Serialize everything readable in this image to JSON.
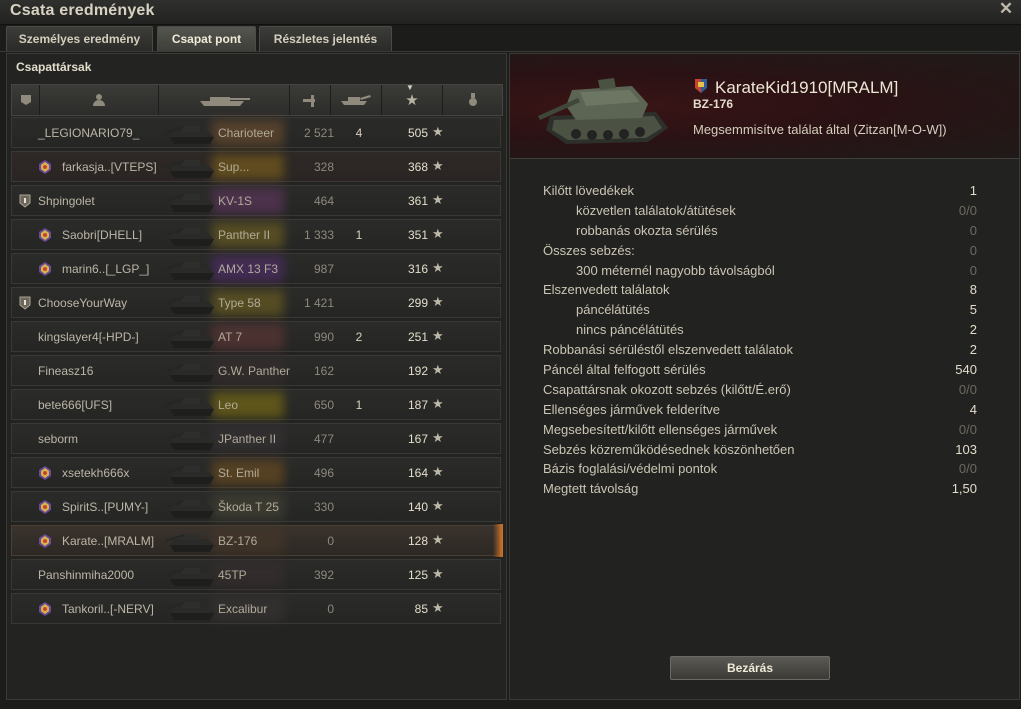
{
  "window": {
    "title": "Csata eredmények"
  },
  "tabs": [
    {
      "label": "Személyes eredmény",
      "active": false
    },
    {
      "label": "Csapat pont",
      "active": true
    },
    {
      "label": "Részletes jelentés",
      "active": false
    }
  ],
  "team": {
    "section_title": "Csapattársak",
    "columns": [
      "squad-icon",
      "player-icon",
      "tank-icon",
      "damage-icon",
      "kills-icon",
      "points-icon",
      "medal-icon"
    ],
    "rows": [
      {
        "name": "_LEGIONARIO79_",
        "badge": "none",
        "vehicle": "Charioteer",
        "damage": "2 521",
        "kills": "4",
        "points": "505",
        "dead": false,
        "color": "#7a5530"
      },
      {
        "name": "farkasja..[VTEPS]",
        "badge": "clan-emblem",
        "vehicle": "Sup...",
        "damage": "328",
        "kills": "",
        "points": "368",
        "dead": true,
        "color": "#8a6a1a"
      },
      {
        "name": "Shpingolet",
        "badge": "platoon",
        "vehicle": "KV-1S",
        "damage": "464",
        "kills": "",
        "points": "361",
        "dead": false,
        "color": "#6a3a6a"
      },
      {
        "name": "Saobri[DHELL]",
        "badge": "clan-emblem",
        "vehicle": "Panther II",
        "damage": "1 333",
        "kills": "1",
        "points": "351",
        "dead": false,
        "color": "#7a6a20"
      },
      {
        "name": "marin6..[_LGP_]",
        "badge": "clan-emblem",
        "vehicle": "AMX 13 F3",
        "damage": "987",
        "kills": "",
        "points": "316",
        "dead": false,
        "color": "#5a2f7a"
      },
      {
        "name": "ChooseYourWay",
        "badge": "platoon",
        "vehicle": "Type 58",
        "damage": "1 421",
        "kills": "",
        "points": "299",
        "dead": false,
        "color": "#7a6a20"
      },
      {
        "name": "kingslayer4[-HPD-]",
        "badge": "none",
        "vehicle": "AT 7",
        "damage": "990",
        "kills": "2",
        "points": "251",
        "dead": false,
        "color": "#6a3a3a"
      },
      {
        "name": "Fineasz16",
        "badge": "none",
        "vehicle": "G.W. Panther",
        "damage": "162",
        "kills": "",
        "points": "192",
        "dead": false,
        "color": "#3a3030"
      },
      {
        "name": "bete666[UFS]",
        "badge": "none",
        "vehicle": "Leo",
        "damage": "650",
        "kills": "1",
        "points": "187",
        "dead": false,
        "color": "#8a7a10"
      },
      {
        "name": "seborm",
        "badge": "none",
        "vehicle": "JPanther II",
        "damage": "477",
        "kills": "",
        "points": "167",
        "dead": false,
        "color": "#3a3438"
      },
      {
        "name": "xsetekh666x",
        "badge": "clan-emblem",
        "vehicle": "St. Emil",
        "damage": "496",
        "kills": "",
        "points": "164",
        "dead": false,
        "color": "#7a5520"
      },
      {
        "name": "SpiritS..[PUMY-]",
        "badge": "clan-emblem",
        "vehicle": "Škoda T 25",
        "damage": "330",
        "kills": "",
        "points": "140",
        "dead": false,
        "color": "#4a4a3a"
      },
      {
        "name": "Karate..[MRALM]",
        "badge": "clan-emblem",
        "vehicle": "BZ-176",
        "damage": "0",
        "kills": "",
        "points": "128",
        "dead": true,
        "selected": true,
        "color": "#4a3a2a"
      },
      {
        "name": "Panshinmiha2000",
        "badge": "none",
        "vehicle": "45TP",
        "damage": "392",
        "kills": "",
        "points": "125",
        "dead": false,
        "color": "#3a3030"
      },
      {
        "name": "Tankoril..[-NERV]",
        "badge": "clan-emblem",
        "vehicle": "Excalibur",
        "damage": "0",
        "kills": "",
        "points": "85",
        "dead": false,
        "color": "#3a3636"
      }
    ]
  },
  "detail": {
    "player_name": "KarateKid1910[MRALM]",
    "vehicle": "BZ-176",
    "destroyed_text": "Megsemmisítve találat által (Zitzan[M-O-W])",
    "stats": [
      {
        "label": "Kilőtt lövedékek",
        "value": "1",
        "sub": false,
        "zero": false
      },
      {
        "label": "közvetlen találatok/átütések",
        "value": "0/0",
        "sub": true,
        "zero": true
      },
      {
        "label": "robbanás okozta sérülés",
        "value": "0",
        "sub": true,
        "zero": true
      },
      {
        "label": "Összes sebzés:",
        "value": "0",
        "sub": false,
        "zero": true
      },
      {
        "label": "300 méternél nagyobb távolságból",
        "value": "0",
        "sub": true,
        "zero": true
      },
      {
        "label": "Elszenvedett találatok",
        "value": "8",
        "sub": false,
        "zero": false
      },
      {
        "label": "páncélátütés",
        "value": "5",
        "sub": true,
        "zero": false
      },
      {
        "label": "nincs páncélátütés",
        "value": "2",
        "sub": true,
        "zero": false
      },
      {
        "label": "Robbanási sérüléstől elszenvedett találatok",
        "value": "2",
        "sub": false,
        "zero": false
      },
      {
        "label": "Páncél által felfogott sérülés",
        "value": "540",
        "sub": false,
        "zero": false
      },
      {
        "label": "Csapattársnak okozott sebzés (kilőtt/É.erő)",
        "value": "0/0",
        "sub": false,
        "zero": true
      },
      {
        "label": "Ellenséges járművek felderítve",
        "value": "4",
        "sub": false,
        "zero": false
      },
      {
        "label": "Megsebesített/kilőtt ellenséges járművek",
        "value": "0/0",
        "sub": false,
        "zero": true
      },
      {
        "label": "Sebzés közreműködésednek köszönhetően",
        "value": "103",
        "sub": false,
        "zero": false
      },
      {
        "label": "Bázis foglalási/védelmi pontok",
        "value": "0/0",
        "sub": false,
        "zero": true
      },
      {
        "label": "Megtett távolság",
        "value": "1,50",
        "sub": false,
        "zero": false
      }
    ],
    "close_label": "Bezárás"
  }
}
